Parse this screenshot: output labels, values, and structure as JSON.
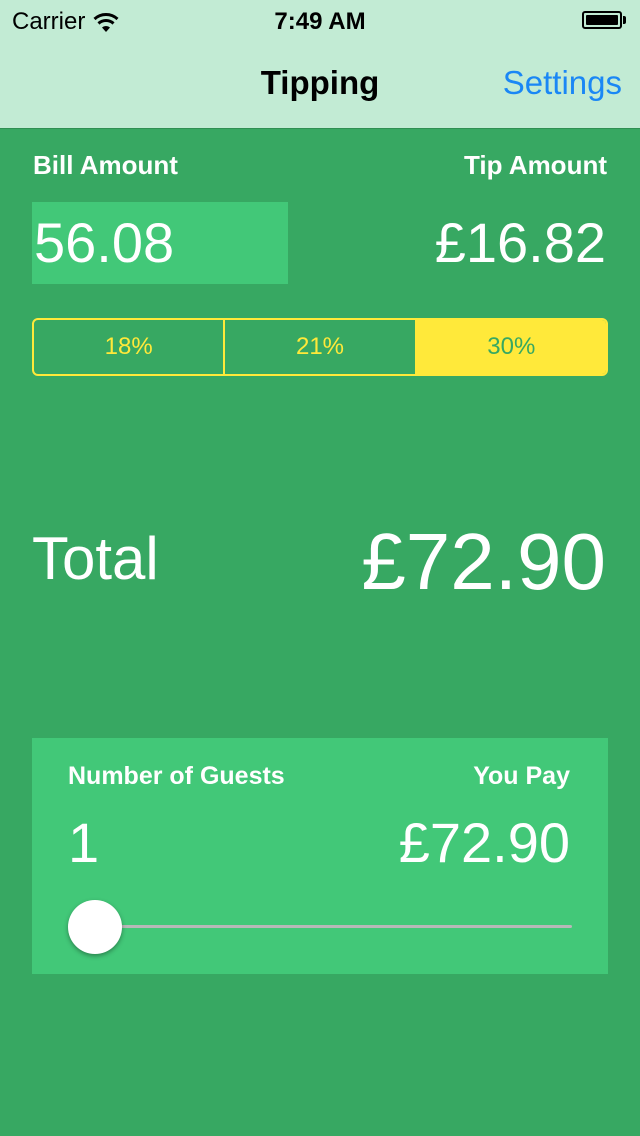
{
  "status_bar": {
    "carrier": "Carrier",
    "time": "7:49 AM",
    "wifi_icon": "wifi-icon",
    "battery_icon": "battery-icon"
  },
  "nav": {
    "title": "Tipping",
    "settings_label": "Settings"
  },
  "bill": {
    "label": "Bill Amount",
    "value": "56.08"
  },
  "tip": {
    "label": "Tip Amount",
    "value": "£16.82"
  },
  "tip_options": [
    {
      "label": "18%",
      "selected": false
    },
    {
      "label": "21%",
      "selected": false
    },
    {
      "label": "30%",
      "selected": true
    }
  ],
  "total": {
    "label": "Total",
    "value": "£72.90"
  },
  "guests": {
    "label": "Number of Guests",
    "count": "1",
    "pay_label": "You Pay",
    "pay_value": "£72.90",
    "slider_value": 1
  },
  "colors": {
    "background": "#37a862",
    "nav_bar": "#c2ebd4",
    "field_green": "#42c878",
    "accent_yellow": "#ffe93a",
    "link_blue": "#1a87f5"
  }
}
